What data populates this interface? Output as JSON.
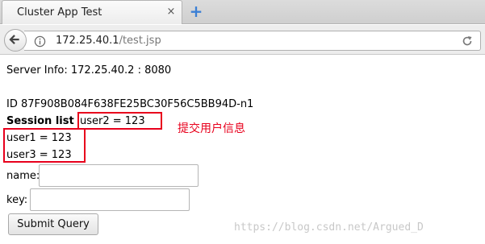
{
  "browser": {
    "tab": {
      "title": "Cluster App Test",
      "close_glyph": "×"
    },
    "new_tab_glyph": "+",
    "url": {
      "host": "172.25.40.1",
      "path": "/test.jsp"
    }
  },
  "page": {
    "server_info": "Server Info: 172.25.40.2 : 8080",
    "session_id": "ID 87F908B084F638FE25BC30F56C5BB94D-n1",
    "session_list_label": "Session list",
    "session_list_first": "user2 = 123",
    "session_items": [
      "user1 = 123",
      "user3 = 123"
    ],
    "annotation": "提交用户信息",
    "form": {
      "name_label": "name:",
      "name_value": "",
      "key_label": "key:",
      "key_value": "",
      "submit_label": "Submit Query"
    },
    "watermark": "https://blog.csdn.net/Argued_D"
  },
  "colors": {
    "highlight_box": "#e8001c",
    "annotation_text": "#e8001c",
    "new_tab_plus": "#3a7fd5"
  },
  "icons": {
    "back": "back-arrow-icon",
    "info": "info-icon",
    "reload": "reload-icon",
    "close": "close-icon",
    "new_tab": "plus-icon"
  }
}
